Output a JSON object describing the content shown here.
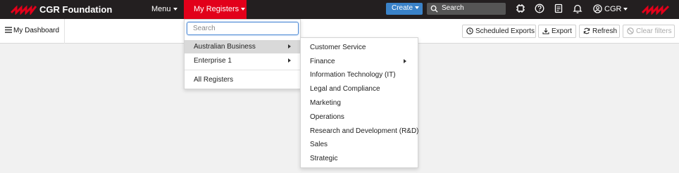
{
  "brand": {
    "name": "CGR Foundation"
  },
  "nav": {
    "menu_label": "Menu",
    "registers_label": "My Registers"
  },
  "header": {
    "create_label": "Create",
    "search_placeholder": "Search",
    "user_label": "CGR"
  },
  "toolbar": {
    "dashboard_label": "My Dashboard",
    "scheduled_exports": "Scheduled Exports",
    "export": "Export",
    "refresh": "Refresh",
    "clear_filters": "Clear filters"
  },
  "registers_menu": {
    "search_placeholder": "Search",
    "items": [
      {
        "label": "Australian Business"
      },
      {
        "label": "Enterprise 1"
      },
      {
        "label": "All Registers"
      }
    ]
  },
  "submenu": {
    "items": [
      {
        "label": "Customer Service"
      },
      {
        "label": "Finance"
      },
      {
        "label": "Information Technology (IT)"
      },
      {
        "label": "Legal and Compliance"
      },
      {
        "label": "Marketing"
      },
      {
        "label": "Operations"
      },
      {
        "label": "Research and Development (R&D)"
      },
      {
        "label": "Sales"
      },
      {
        "label": "Strategic"
      }
    ]
  },
  "colors": {
    "topbar": "#231f20",
    "accent_red": "#e2001a",
    "create_blue": "#3a82c8"
  }
}
